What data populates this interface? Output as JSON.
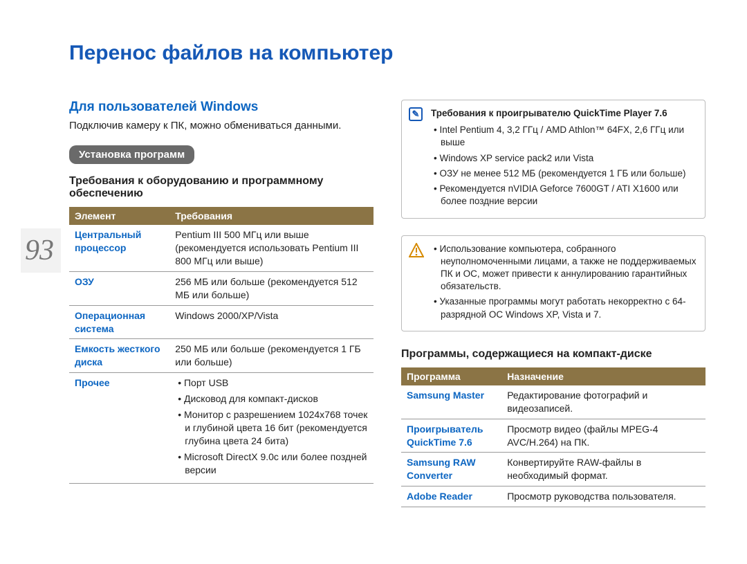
{
  "page_number": "93",
  "title": "Перенос файлов на компьютер",
  "left": {
    "heading": "Для пользователей Windows",
    "intro": "Подключив камеру к ПК, можно обмениваться данными.",
    "chip": "Установка программ",
    "subheading": "Требования к оборудованию и программному обеспечению",
    "req_table": {
      "header": {
        "col1": "Элемент",
        "col2": "Требования"
      },
      "rows": [
        {
          "label": "Центральный процессор",
          "value": "Pentium III 500 МГц или выше (рекомендуется использовать Pentium III 800 МГц или выше)"
        },
        {
          "label": "ОЗУ",
          "value": "256 МБ или больше (рекомендуется 512 МБ или больше)"
        },
        {
          "label": "Операционная система",
          "value": "Windows 2000/XP/Vista"
        },
        {
          "label": "Емкость жесткого диска",
          "value": "250 МБ или больше (рекомендуется 1 ГБ или больше)"
        },
        {
          "label": "Прочее",
          "bullets": [
            "Порт USB",
            "Дисковод для компакт-дисков",
            "Монитор с разрешением 1024x768 точек и глубиной цвета 16 бит (рекомендуется глубина цвета 24 бита)",
            "Microsoft DirectX 9.0c или более поздней версии"
          ]
        }
      ]
    }
  },
  "right": {
    "note1": {
      "title": "Требования к проигрывателю QuickTime Player 7.6",
      "bullets": [
        "Intel Pentium 4, 3,2 ГГц / AMD Athlon™ 64FX, 2,6 ГГц или выше",
        "Windows XP service pack2 или Vista",
        "ОЗУ не менее 512 МБ (рекомендуется 1 ГБ или больше)",
        "Рекомендуется nVIDIA Geforce 7600GT / ATI X1600 или более поздние версии"
      ]
    },
    "note2": {
      "bullets": [
        "Использование компьютера, собранного неуполномоченными лицами, а также не поддерживаемых ПК и ОС, может привести к аннулированию гарантийных обязательств.",
        "Указанные программы могут работать некорректно с 64-разрядной ОС Windows XP, Vista и 7."
      ]
    },
    "programs_heading": "Программы, содержащиеся на компакт-диске",
    "prog_table": {
      "header": {
        "col1": "Программа",
        "col2": "Назначение"
      },
      "rows": [
        {
          "label": "Samsung Master",
          "value": "Редактирование фотографий и видеозаписей."
        },
        {
          "label": "Проигрыватель QuickTime 7.6",
          "value": "Просмотр видео (файлы MPEG-4 AVC/H.264) на ПК."
        },
        {
          "label": "Samsung RAW Converter",
          "value": "Конвертируйте RAW-файлы в необходимый формат."
        },
        {
          "label": "Adobe Reader",
          "value": "Просмотр руководства пользователя."
        }
      ]
    }
  }
}
